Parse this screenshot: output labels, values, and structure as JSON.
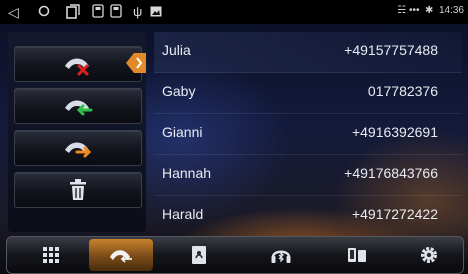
{
  "status_bar": {
    "time": "14:36",
    "signal_text": "•••"
  },
  "actions": [
    {
      "name": "reject-call-button",
      "icon": "phone-reject-icon"
    },
    {
      "name": "incoming-calls-button",
      "icon": "phone-incoming-icon"
    },
    {
      "name": "outgoing-calls-button",
      "icon": "phone-outgoing-icon"
    },
    {
      "name": "delete-button",
      "icon": "trash-icon"
    }
  ],
  "contacts": [
    {
      "name": "Julia",
      "number": "+49157757488"
    },
    {
      "name": "Gaby",
      "number": "017782376"
    },
    {
      "name": "Gianni",
      "number": "+4916392691"
    },
    {
      "name": "Hannah",
      "number": "+49176843766"
    },
    {
      "name": "Harald",
      "number": "+4917272422"
    }
  ],
  "nav": [
    {
      "name": "keypad",
      "icon": "keypad-icon",
      "active": false
    },
    {
      "name": "call-log",
      "icon": "call-log-icon",
      "active": true
    },
    {
      "name": "contacts",
      "icon": "contacts-book-icon",
      "active": false
    },
    {
      "name": "bluetooth-music",
      "icon": "bluetooth-music-icon",
      "active": false
    },
    {
      "name": "device-pairing",
      "icon": "device-pairing-icon",
      "active": false
    },
    {
      "name": "settings",
      "icon": "settings-gear-icon",
      "active": false
    }
  ],
  "colors": {
    "accent_orange": "#e08a2a",
    "reject_red": "#e02020",
    "incoming_green": "#2ec04a",
    "outgoing_orange": "#f08a20"
  }
}
